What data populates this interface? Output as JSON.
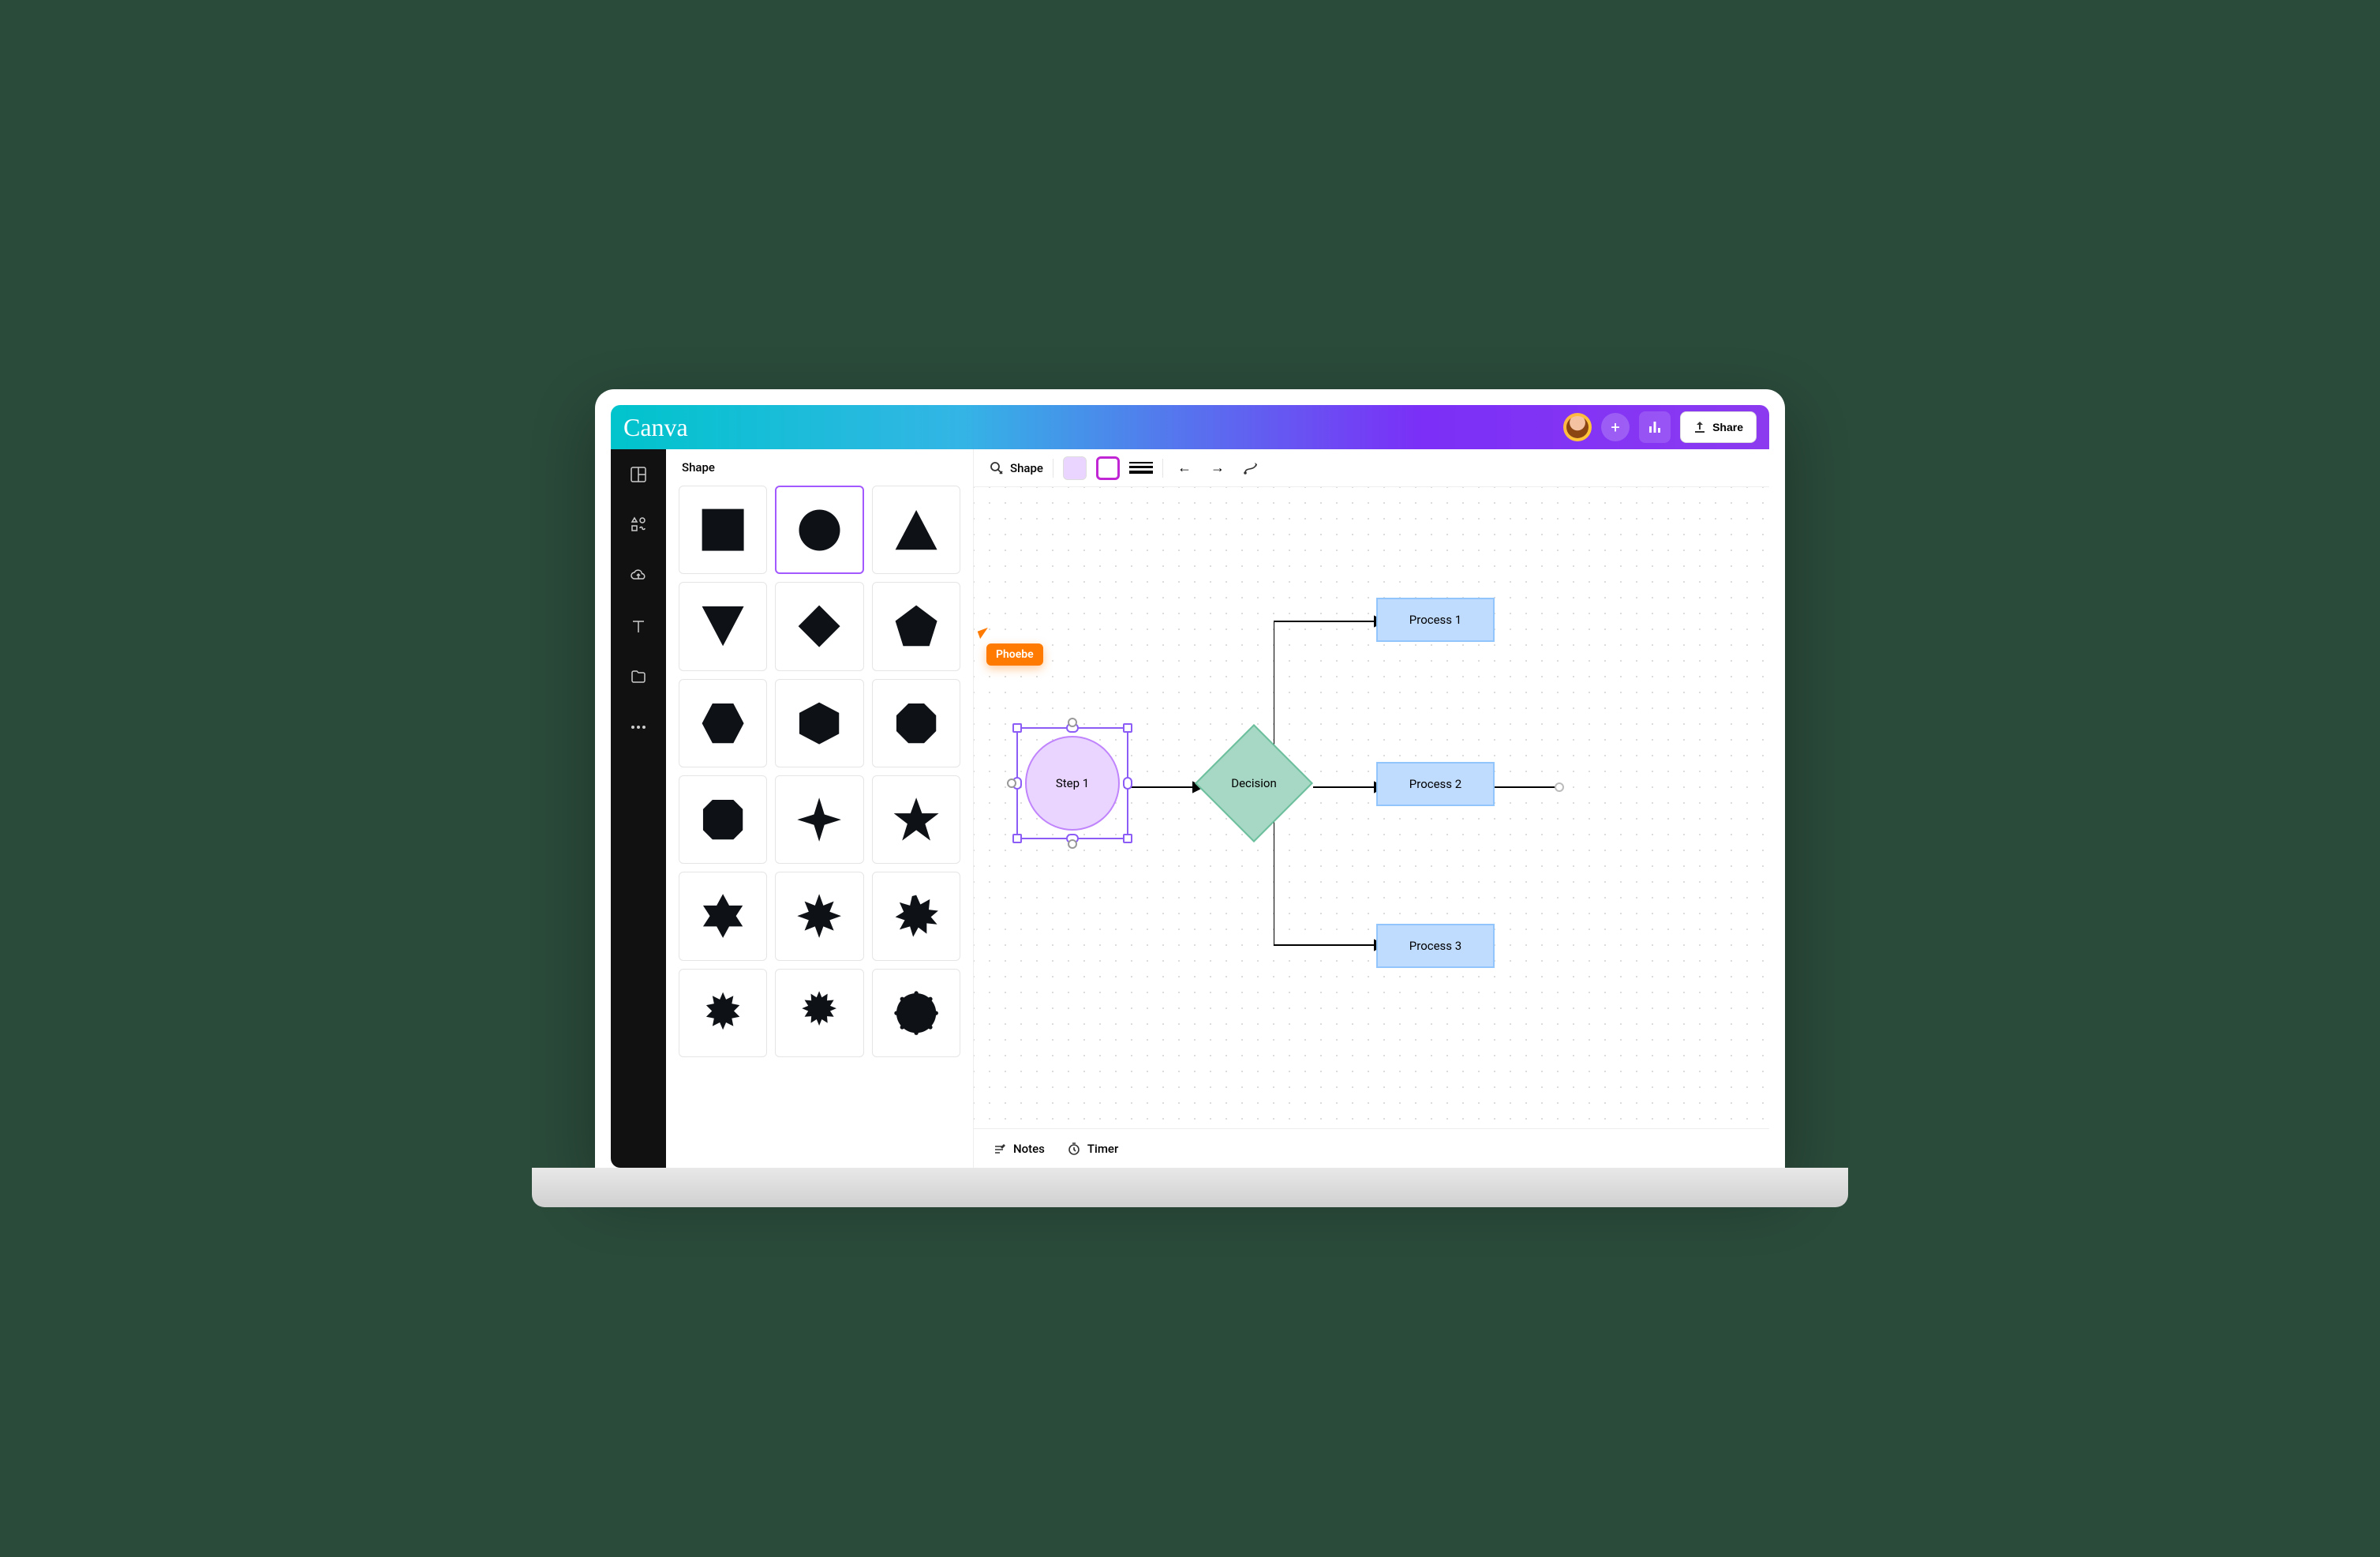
{
  "app": {
    "logo": "Canva"
  },
  "topbar": {
    "share_label": "Share"
  },
  "sidebar_icons": [
    "grid-icon",
    "elements-icon",
    "cloud-upload-icon",
    "text-icon",
    "folder-icon",
    "more-icon"
  ],
  "panel": {
    "title": "Shape",
    "shapes": [
      "square",
      "circle",
      "triangle",
      "triangle-down",
      "diamond",
      "pentagon",
      "hexagon",
      "heptagon",
      "octagon",
      "rounded-square",
      "star-4",
      "star-5",
      "star-6",
      "star-8",
      "starburst-12",
      "burst-12",
      "burst-16",
      "burst-round"
    ],
    "selected_index": 1
  },
  "toolbar": {
    "shape_label": "Shape",
    "fill_color": "#e9d5ff",
    "stroke_color": "#c026d3"
  },
  "collaborator": {
    "name": "Phoebe",
    "color": "#ff7a00"
  },
  "canvas": {
    "step1": {
      "label": "Step 1"
    },
    "decision": {
      "label": "Decision"
    },
    "process1": {
      "label": "Process 1"
    },
    "process2": {
      "label": "Process 2"
    },
    "process3": {
      "label": "Process 3"
    }
  },
  "bottombar": {
    "notes_label": "Notes",
    "timer_label": "Timer"
  }
}
